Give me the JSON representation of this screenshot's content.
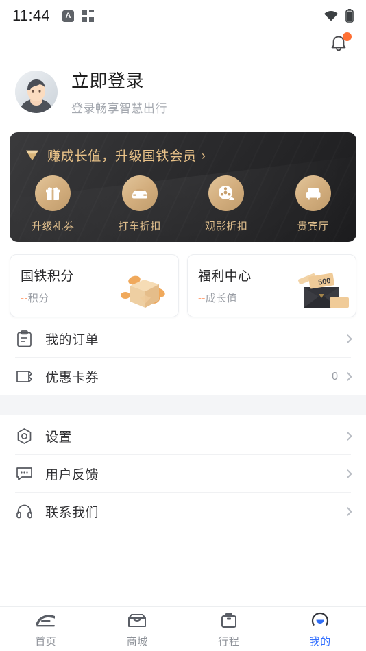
{
  "statusbar": {
    "time": "11:44",
    "icon_a_letter": "A",
    "icons": [
      "app-badge-icon",
      "grid-apps-icon",
      "wifi-icon",
      "battery-icon"
    ]
  },
  "header": {
    "bell": {
      "name": "notification-bell-icon",
      "has_badge": true,
      "badge_color": "#ff7034"
    }
  },
  "profile": {
    "avatar_alt": "default-user-avatar",
    "name": "立即登录",
    "subtitle": "登录畅享智慧出行"
  },
  "member_card": {
    "title": "赚成长值，升级国铁会员",
    "arrow": "›",
    "gem_icon": "diamond-badge-icon",
    "accent_color": "#e9c288",
    "benefits": [
      {
        "label": "升级礼券",
        "icon": "gift-icon"
      },
      {
        "label": "打车折扣",
        "icon": "car-icon"
      },
      {
        "label": "观影折扣",
        "icon": "film-reel-icon"
      },
      {
        "label": "贵宾厅",
        "icon": "lounge-chair-icon"
      }
    ]
  },
  "points_cards": [
    {
      "title": "国铁积分",
      "dash": "--",
      "unit": "积分",
      "art": "gift-box-coins-illustration"
    },
    {
      "title": "福利中心",
      "dash": "--",
      "unit": "成长值",
      "art": "envelope-voucher-illustration",
      "voucher_value": "500"
    }
  ],
  "menu_group_1": [
    {
      "label": "我的订单",
      "icon": "clipboard-order-icon",
      "value": ""
    },
    {
      "label": "优惠卡券",
      "icon": "coupon-ticket-icon",
      "value": "0"
    }
  ],
  "menu_group_2": [
    {
      "label": "设置",
      "icon": "settings-gear-icon",
      "value": ""
    },
    {
      "label": "用户反馈",
      "icon": "feedback-bubble-icon",
      "value": ""
    },
    {
      "label": "联系我们",
      "icon": "headphones-support-icon",
      "value": ""
    }
  ],
  "bottom_nav": {
    "active_color": "#3370ff",
    "inactive_color": "#8e9299",
    "items": [
      {
        "label": "首页",
        "icon": "train-icon",
        "active": false
      },
      {
        "label": "商城",
        "icon": "shop-icon",
        "active": false
      },
      {
        "label": "行程",
        "icon": "trip-briefcase-icon",
        "active": false
      },
      {
        "label": "我的",
        "icon": "profile-person-icon",
        "active": true
      }
    ]
  }
}
